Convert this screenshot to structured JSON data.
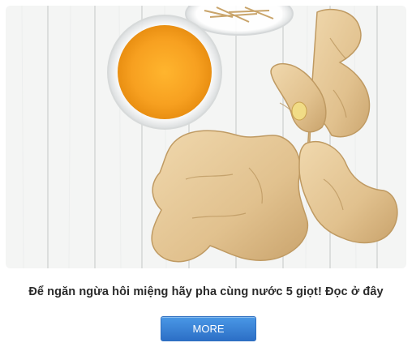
{
  "article": {
    "caption": "Để ngăn ngừa hôi miệng hãy pha cùng nước 5 giọt! Đọc ở đây",
    "more_label": "MORE"
  },
  "colors": {
    "button_top": "#4a98e6",
    "button_bottom": "#2c6fc6",
    "caption_text": "#2a2a2a",
    "turmeric": "#f6a722",
    "ginger": "#e4c89a",
    "wood": "#f2f3f2"
  },
  "image": {
    "subject": "ginger root with bowl of turmeric powder on white wooden boards"
  }
}
